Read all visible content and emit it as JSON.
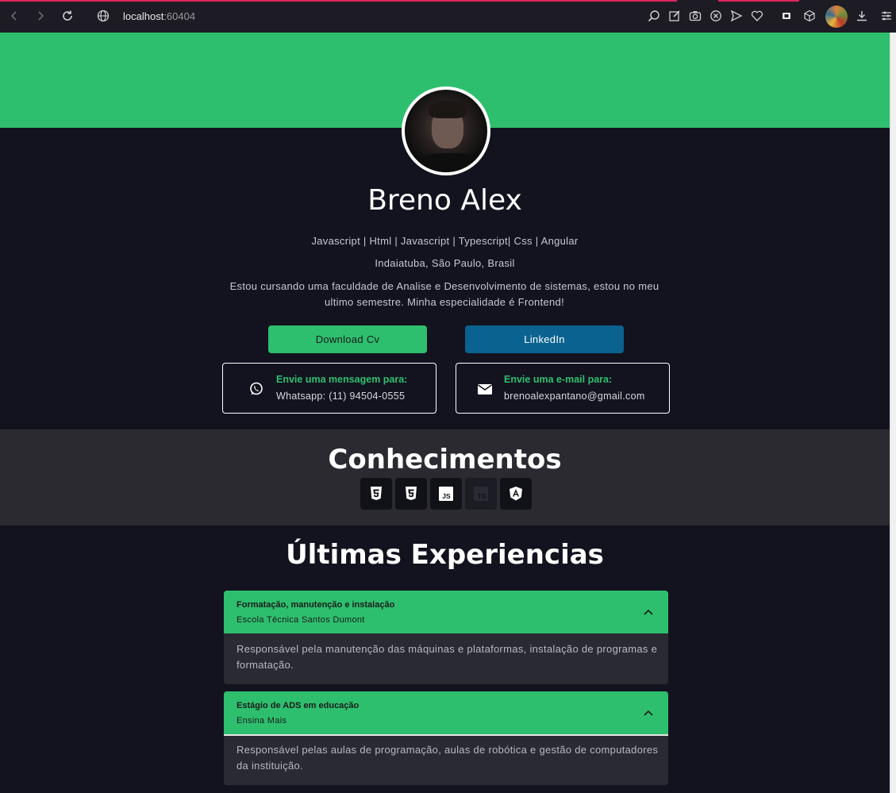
{
  "browser": {
    "url_host": "localhost",
    "url_port": ":60404",
    "toolbar_icons": [
      "zoom-icon",
      "edit-icon",
      "camera-icon",
      "close-circle-icon",
      "send-icon",
      "heart-icon",
      "extension-icon",
      "cube-icon",
      "profile-avatar",
      "download-icon",
      "menu-icon"
    ]
  },
  "profile": {
    "name": "Breno Alex",
    "skills": "Javascript | Html | Javascript | Typescript| Css | Angular",
    "location": "Indaiatuba, São Paulo, Brasil",
    "about": "Estou cursando uma faculdade de Analise e Desenvolvimento de sistemas, estou no meu ultimo semestre. Minha especialidade é Frontend!"
  },
  "actions": {
    "download_cv": "Download Cv",
    "linkedin": "LinkedIn"
  },
  "contacts": {
    "whatsapp": {
      "title": "Envie uma mensagem para:",
      "value": "Whatsapp: (11) 94504-0555"
    },
    "email": {
      "title": "Envie uma e-mail para:",
      "value": "brenoalexpantano@gmail.com"
    }
  },
  "knowledge": {
    "title": "Conhecimentos",
    "techs": [
      "html5-icon",
      "css3-icon",
      "javascript-icon",
      "typescript-icon",
      "angular-icon"
    ]
  },
  "experiences": {
    "title": "Últimas Experiencias",
    "items": [
      {
        "role": "Formatação, manutenção e instalação",
        "place": "Escola Técnica Santos Dumont",
        "description": "Responsável pela manutenção das máquinas e plataformas, instalação de programas e formatação."
      },
      {
        "role": "Estágio de ADS em educação",
        "place": "Ensina Mais",
        "description": "Responsável pelas aulas de programação, aulas de robótica e gestão de computadores da instituição."
      }
    ]
  },
  "colors": {
    "accent": "#2ebf6e",
    "linkedin": "#0a6290",
    "background": "#13131f",
    "section": "#2a2a30"
  }
}
